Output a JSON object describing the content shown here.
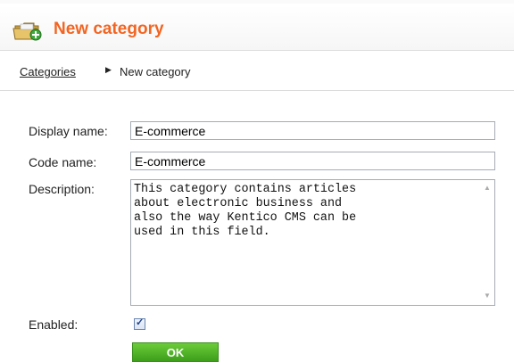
{
  "header": {
    "title": "New category",
    "icon": "folder-add-icon"
  },
  "breadcrumb": {
    "link": "Categories",
    "current": "New category"
  },
  "form": {
    "display_name_label": "Display name:",
    "display_name_value": "E-commerce",
    "code_name_label": "Code name:",
    "code_name_value": "E-commerce",
    "description_label": "Description:",
    "description_value": "This category contains articles\nabout electronic business and\nalso the way Kentico CMS can be\nused in this field.",
    "enabled_label": "Enabled:",
    "enabled": true,
    "ok_label": "OK"
  },
  "colors": {
    "title": "#f26522",
    "ok_button": "#4cb025"
  }
}
